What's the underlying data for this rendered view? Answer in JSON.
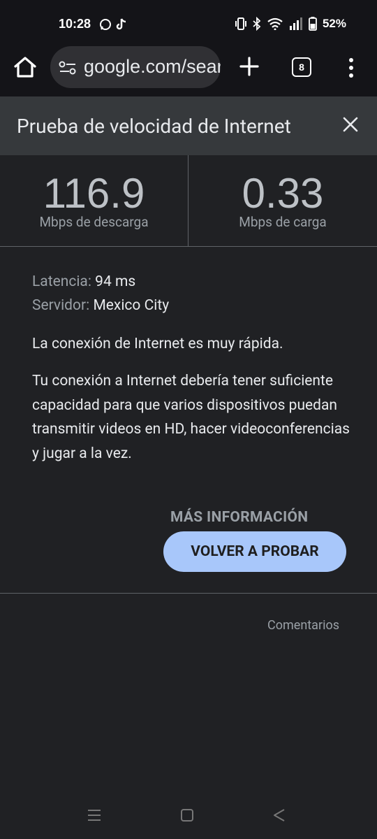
{
  "status_bar": {
    "time": "10:28",
    "battery": "52%",
    "left_icons": [
      "whatsapp-icon",
      "tiktok-icon"
    ],
    "right_icons": [
      "vibrate-icon",
      "bluetooth-icon",
      "wifi-icon",
      "signal-icon",
      "battery-icon"
    ]
  },
  "browser": {
    "url": "google.com/search?q=speed+test",
    "tab_count": "8"
  },
  "card": {
    "title": "Prueba de velocidad de Internet",
    "download_value": "116.9",
    "download_unit": "Mbps de descarga",
    "upload_value": "0.33",
    "upload_unit": "Mbps de carga",
    "latency_label": "Latencia:",
    "latency_value": "94 ms",
    "server_label": "Servidor:",
    "server_value": "Mexico City",
    "message_short": "La conexión de Internet es muy rápida.",
    "message_long": "Tu conexión a Internet debería tener suficiente capacidad para que varios dispositivos puedan transmitir videos en HD, hacer videoconferencias y jugar a la vez.",
    "more_info_label": "MÁS INFORMACIÓN",
    "retry_label": "VOLVER A PROBAR",
    "feedback_label": "Comentarios"
  },
  "colors": {
    "background": "#202124",
    "header_bg": "#36393c",
    "accent_button": "#a8c7fa"
  }
}
